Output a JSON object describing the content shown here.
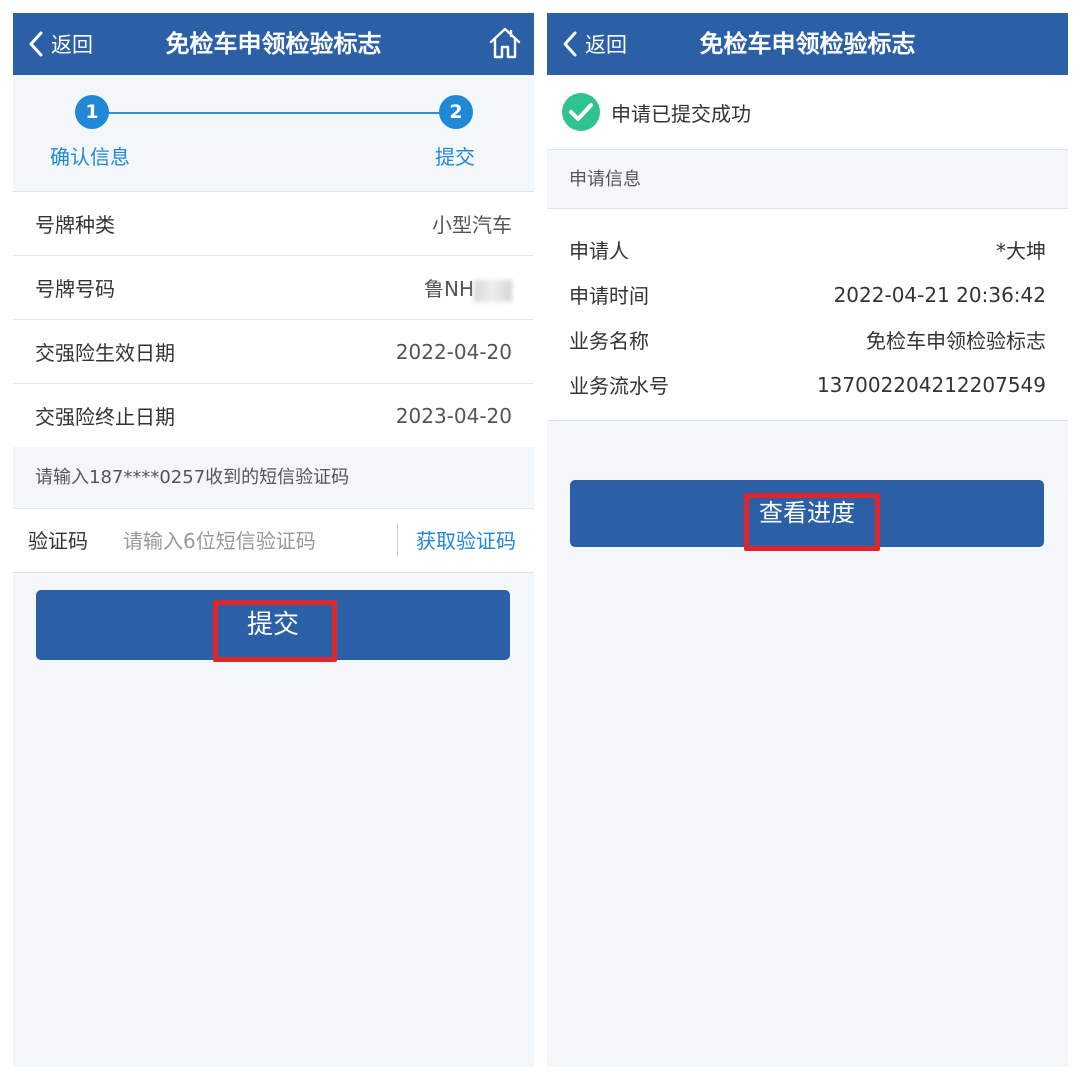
{
  "left": {
    "header": {
      "back_label": "返回",
      "title": "免检车申领检验标志"
    },
    "steps": [
      {
        "number": "1",
        "label": "确认信息"
      },
      {
        "number": "2",
        "label": "提交"
      }
    ],
    "rows": [
      {
        "label": "号牌种类",
        "value": "小型汽车"
      },
      {
        "label": "号牌号码",
        "value": "鲁NH"
      },
      {
        "label": "交强险生效日期",
        "value": "2022-04-20"
      },
      {
        "label": "交强险终止日期",
        "value": "2023-04-20"
      }
    ],
    "sms_tip": "请输入187****0257收到的短信验证码",
    "code": {
      "label": "验证码",
      "placeholder": "请输入6位短信验证码",
      "value": "",
      "get_code_label": "获取验证码"
    },
    "submit_label": "提交"
  },
  "right": {
    "header": {
      "back_label": "返回",
      "title": "免检车申领检验标志"
    },
    "success_text": "申请已提交成功",
    "section_title": "申请信息",
    "info": [
      {
        "label": "申请人",
        "value": "*大坤"
      },
      {
        "label": "申请时间",
        "value": "2022-04-21 20:36:42"
      },
      {
        "label": "业务名称",
        "value": "免检车申领检验标志"
      },
      {
        "label": "业务流水号",
        "value": "137002204212207549"
      }
    ],
    "progress_label": "查看进度"
  },
  "colors": {
    "header_bg": "#2b5fa6",
    "accent": "#2188d8",
    "highlight": "#e0262d",
    "success": "#2fc48d"
  },
  "icons": [
    "chevron-left-icon",
    "home-icon",
    "check-circle-icon"
  ]
}
